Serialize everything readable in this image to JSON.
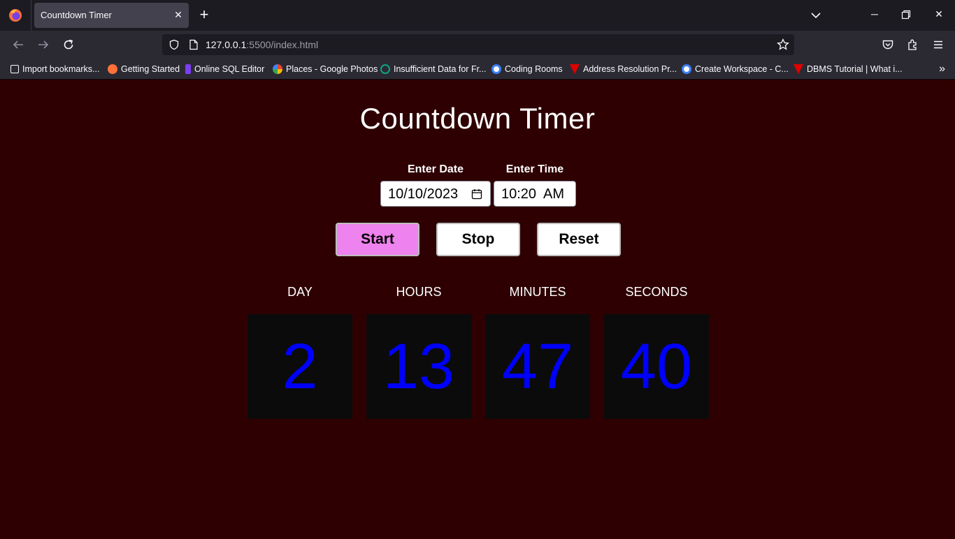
{
  "browser": {
    "tab_title": "Countdown Timer",
    "url_host": "127.0.0.1",
    "url_rest": ":5500/index.html",
    "bookmarks": [
      {
        "label": "Import bookmarks...",
        "icon": "import-icon",
        "color": "#fbfbfe"
      },
      {
        "label": "Getting Started",
        "icon": "firefox-icon",
        "color": "#ff7139"
      },
      {
        "label": "Online SQL Editor",
        "icon": "sql-icon",
        "color": "#7b3ff2"
      },
      {
        "label": "Places - Google Photos",
        "icon": "google-photos-icon",
        "color": "#fbbc04"
      },
      {
        "label": "Insufficient Data for Fr...",
        "icon": "chatgpt-icon",
        "color": "#10a37f"
      },
      {
        "label": "Coding Rooms",
        "icon": "coding-rooms-icon",
        "color": "#3b82f6"
      },
      {
        "label": "Address Resolution Pr...",
        "icon": "tutorial-icon",
        "color": "#e00000"
      },
      {
        "label": "Create Workspace - C...",
        "icon": "workspace-icon",
        "color": "#3b82f6"
      },
      {
        "label": "DBMS Tutorial | What i...",
        "icon": "tutorial-icon",
        "color": "#e00000"
      }
    ]
  },
  "page": {
    "title": "Countdown Timer",
    "date_label": "Enter Date",
    "date_value": "10/10/2023",
    "time_label": "Enter Time",
    "time_value": "10:20  AM",
    "buttons": {
      "start": "Start",
      "stop": "Stop",
      "reset": "Reset"
    },
    "units": [
      {
        "label": "DAY",
        "value": "2"
      },
      {
        "label": "HOURS",
        "value": "13"
      },
      {
        "label": "MINUTES",
        "value": "47"
      },
      {
        "label": "SECONDS",
        "value": "40"
      }
    ],
    "colors": {
      "background": "#2e0002",
      "start_button": "#ee82ee",
      "digits": "#0000ff",
      "digit_box": "#0b0b0b"
    }
  }
}
